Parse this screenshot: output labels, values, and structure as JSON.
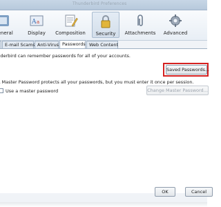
{
  "window": {
    "title": "Thunderbird Preferences"
  },
  "toolbar": {
    "items": [
      {
        "label": "General"
      },
      {
        "label": "Display"
      },
      {
        "label": "Composition"
      },
      {
        "label": "Security",
        "active": true
      },
      {
        "label": "Attachments"
      },
      {
        "label": "Advanced"
      }
    ]
  },
  "tabs": [
    {
      "label": "E-mail Scams"
    },
    {
      "label": "Anti-Virus"
    },
    {
      "label": "Passwords",
      "active": true
    },
    {
      "label": "Web Content"
    }
  ],
  "passwords": {
    "intro": "Thunderbird can remember passwords for all of your accounts.",
    "saved_button": "Saved Passwords...",
    "master_desc": "A Master Password protects all your passwords, but you must enter it once per session.",
    "use_master_label": "Use a master password",
    "use_master_checked": false,
    "change_master_button": "Change Master Password..."
  },
  "footer": {
    "ok": "OK",
    "cancel": "Cancel"
  },
  "colors": {
    "highlight": "#d42020",
    "active_tab": "#ffffff",
    "toolbar_bg": "#eef2f7"
  },
  "icons": [
    "general-icon",
    "display-icon",
    "composition-icon",
    "security-lock-icon",
    "attachments-icon",
    "advanced-gear-icon"
  ]
}
